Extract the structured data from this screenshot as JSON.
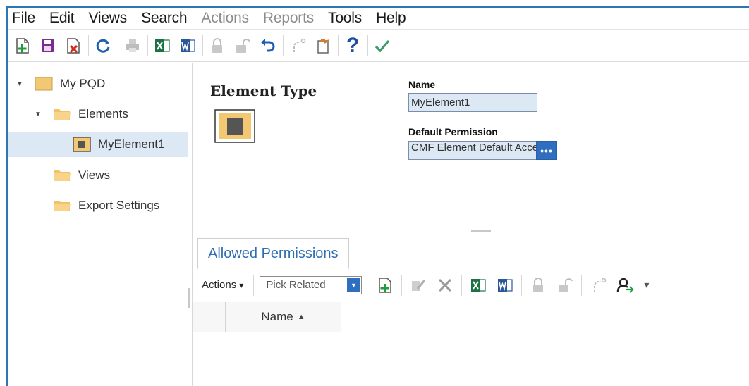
{
  "menu": {
    "items": [
      {
        "label": "File",
        "enabled": true
      },
      {
        "label": "Edit",
        "enabled": true
      },
      {
        "label": "Views",
        "enabled": true
      },
      {
        "label": "Search",
        "enabled": true
      },
      {
        "label": "Actions",
        "enabled": false
      },
      {
        "label": "Reports",
        "enabled": false
      },
      {
        "label": "Tools",
        "enabled": true
      },
      {
        "label": "Help",
        "enabled": true
      }
    ]
  },
  "toolbar": {
    "icons": [
      "new-icon",
      "save-icon",
      "delete-icon",
      "refresh-icon",
      "print-icon",
      "excel-export-icon",
      "word-export-icon",
      "lock-icon",
      "unlock-icon",
      "undo-icon",
      "redo-icon",
      "clipboard-icon",
      "help-icon",
      "checkmark-icon"
    ],
    "help_glyph": "?"
  },
  "tree": {
    "root": "My PQD",
    "elements_folder": "Elements",
    "selected_element": "MyElement1",
    "views_folder": "Views",
    "export_folder": "Export Settings"
  },
  "main": {
    "element_type_title": "Element Type",
    "name_label": "Name",
    "name_value": "MyElement1",
    "default_permission_label": "Default Permission",
    "default_permission_value": "CMF Element Default Access",
    "browse_glyph": "•••"
  },
  "tabs": {
    "allowed_permissions": "Allowed Permissions"
  },
  "subtoolbar": {
    "actions_label": "Actions",
    "actions_arrow": "▾",
    "pick_related_label": "Pick Related",
    "dropdown_arrow": "▼",
    "more_arrow": "▾"
  },
  "grid": {
    "columns": [
      "Name"
    ],
    "sort_indicator": "▲"
  },
  "colors": {
    "accent_blue": "#2f6fbf",
    "selection_bg": "#dde8f5",
    "folder_yellow": "#f3c873",
    "excel_green": "#1e7145",
    "word_blue": "#2b579a"
  }
}
